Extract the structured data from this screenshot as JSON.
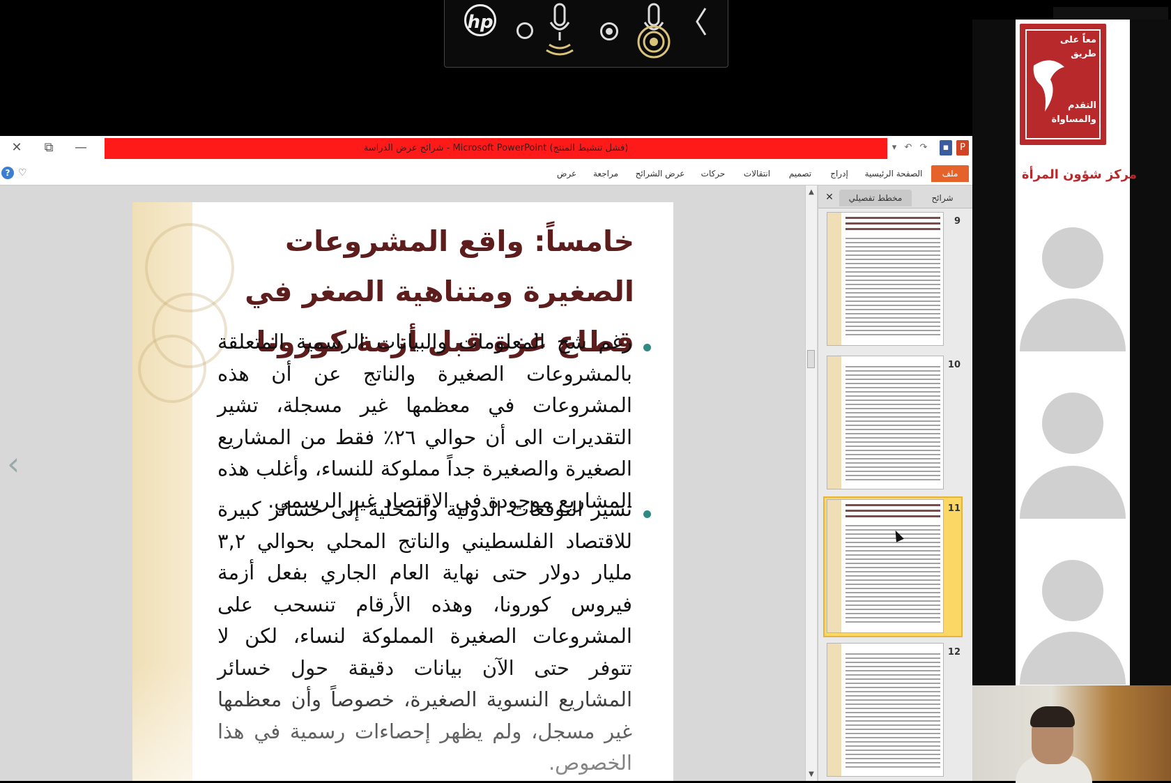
{
  "meeting_bar": {
    "logo": "hp",
    "icons": [
      "hp-logo-icon",
      "record-off-icon",
      "microphone-icon",
      "record-icon",
      "microphone-active-icon",
      "chevron-left-icon"
    ]
  },
  "window": {
    "title": "شرائح عرض الدراسة - Microsoft PowerPoint (فشل تنشيط المنتج)",
    "controls": {
      "close": "✕",
      "restore": "⧉",
      "minimize": "—"
    },
    "accent": "#ff1a1a"
  },
  "ribbon": {
    "tabs": [
      "ملف",
      "الصفحة الرئيسية",
      "إدراج",
      "تصميم",
      "انتقالات",
      "حركات",
      "عرض الشرائح",
      "مراجعة",
      "عرض"
    ],
    "file_tab_color": "#e5632a"
  },
  "panel": {
    "tabs": [
      "شرائح",
      "مخطط تفصيلي"
    ],
    "close": "✕",
    "thumbnails": [
      {
        "number": "9",
        "selected": false
      },
      {
        "number": "10",
        "selected": false
      },
      {
        "number": "11",
        "selected": true
      },
      {
        "number": "12",
        "selected": false
      }
    ]
  },
  "slide": {
    "title": "خامساً: واقع المشروعات الصغيرة ومتناهية الصغر في قطاع غزة قبل أزمة كورونا",
    "bullets": [
      "رغم شح المعلومات والبيانات الرسمية المتعلقة بالمشروعات الصغيرة والناتج عن أن هذه المشروعات في معظمها غير مسجلة، تشير التقديرات الى أن حوالي ٢٦٪ فقط من المشاريع الصغيرة والصغيرة جداً مملوكة للنساء، وأغلب هذه المشاريع موجودة في الاقتصاد غير الرسمي.",
      "تشير التوقعات الدولية والمحلية إلى خسائر كبيرة للاقتصاد الفلسطيني والناتج المحلي بحوالي ٣,٢ مليار دولار حتى نهاية العام الجاري بفعل أزمة فيروس كورونا، وهذه الأرقام تنسحب على المشروعات الصغيرة المملوكة لنساء، لكن لا تتوفر حتى الآن بيانات دقيقة حول خسائر المشاريع النسوية الصغيرة، خصوصاً وأن معظمها غير مسجل، ولم يظهر إحصاءات رسمية في هذا الخصوص."
    ],
    "title_color": "#5e1d1d",
    "bullet_color": "#2f8a86"
  },
  "participants": {
    "org_logo_words": [
      "معاً على",
      "طريق",
      "التقدم",
      "والمساواة"
    ],
    "org_name": "مركز شؤون المرأة",
    "org_color": "#b8292b",
    "avatars": 3
  }
}
